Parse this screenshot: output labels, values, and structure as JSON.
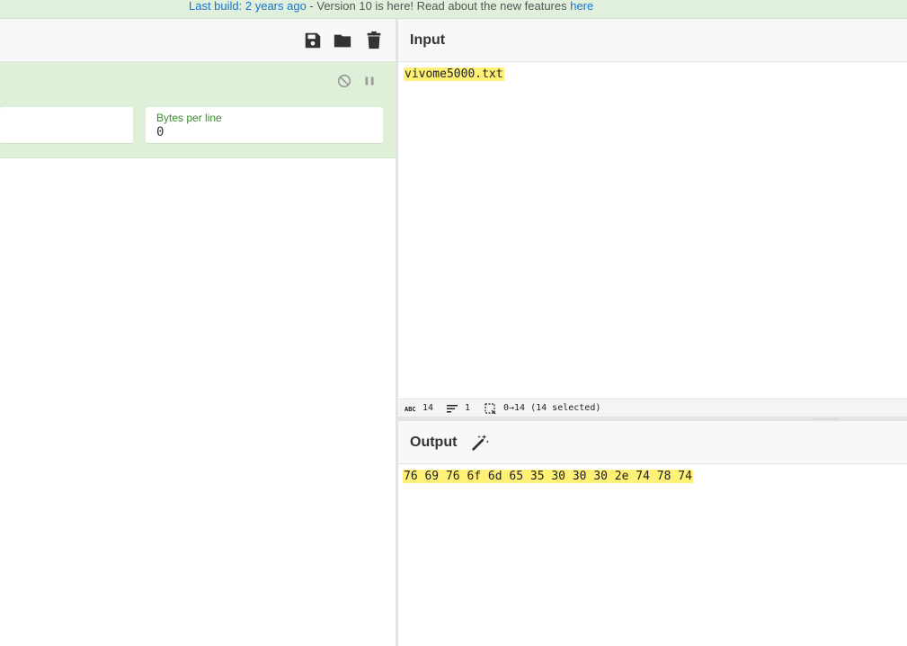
{
  "banner": {
    "last_build_link": "Last build: 2 years ago",
    "mid_text": " - Version 10 is here! Read about the new features ",
    "here_link": "here"
  },
  "recipe": {
    "toolbar_icons": [
      "save-icon",
      "folder-icon",
      "trash-icon"
    ],
    "operation": {
      "controls": [
        "disable-icon",
        "pause-icon"
      ],
      "bytes_per_line_label": "Bytes per line",
      "bytes_per_line_value": "0"
    }
  },
  "input": {
    "title": "Input",
    "text": "vivome5000.txt"
  },
  "status": {
    "chars": "14",
    "lines": "1",
    "selection": "0→14 (14 selected)"
  },
  "output": {
    "title": "Output",
    "text": "76 69 76 6f 6d 65 35 30 30 30 2e 74 78 74"
  },
  "colors": {
    "banner_bg": "#e0f0dc",
    "operation_bg": "#dff0d8",
    "highlight": "#fff176",
    "link": "#1a73c7"
  }
}
